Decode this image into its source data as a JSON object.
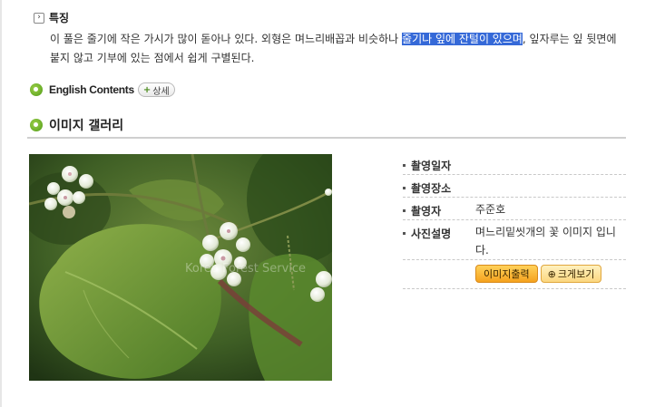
{
  "feature": {
    "title": "특징",
    "text_before": "이 풀은 줄기에 작은 가시가 많이 돋아나 있다. 외형은 며느리배꼽과 비슷하나 ",
    "text_highlight": "줄기나 잎에 잔털이 있으며",
    "text_after": ", 잎자루는 잎 뒷면에 붙지 않고 기부에 있는 점에서 쉽게 구별된다."
  },
  "english": {
    "label": "English Contents",
    "detail_button": "상세"
  },
  "gallery": {
    "title": "이미지 갤러리",
    "photo_watermark": "Korea Forest Service"
  },
  "info": {
    "rows": [
      {
        "key": "촬영일자",
        "value": ""
      },
      {
        "key": "촬영장소",
        "value": ""
      },
      {
        "key": "촬영자",
        "value": "주준호"
      },
      {
        "key": "사진설명",
        "value": "며느리밑씻개의 꽃 이미지 입니다."
      }
    ],
    "print_button": "이미지출력",
    "zoom_button": "크게보기"
  }
}
